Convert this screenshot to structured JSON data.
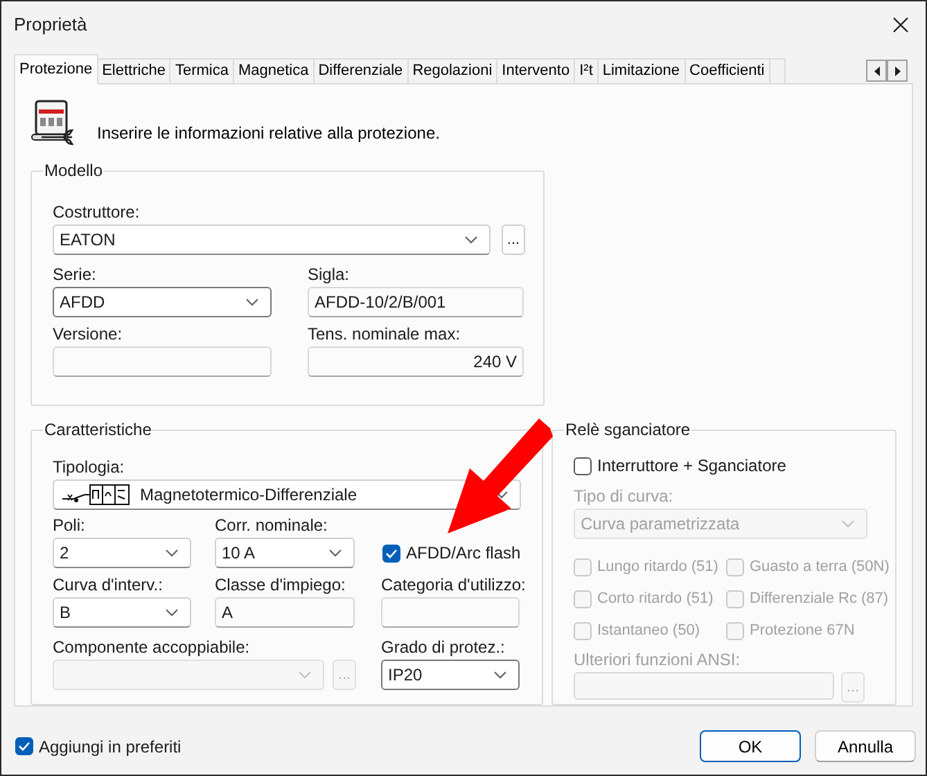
{
  "window": {
    "title": "Proprietà"
  },
  "tabs": [
    {
      "label": "Protezione",
      "selected": true
    },
    {
      "label": "Elettriche",
      "selected": false
    },
    {
      "label": "Termica",
      "selected": false
    },
    {
      "label": "Magnetica",
      "selected": false
    },
    {
      "label": "Differenziale",
      "selected": false
    },
    {
      "label": "Regolazioni",
      "selected": false
    },
    {
      "label": "Intervento",
      "selected": false
    },
    {
      "label": "I²t",
      "selected": false
    },
    {
      "label": "Limitazione",
      "selected": false
    },
    {
      "label": "Coefficienti",
      "selected": false
    }
  ],
  "intro": "Inserire le informazioni relative alla protezione.",
  "modello": {
    "legend": "Modello",
    "costruttore": {
      "label": "Costruttore:",
      "value": "EATON",
      "button": "..."
    },
    "serie": {
      "label": "Serie:",
      "value": "AFDD"
    },
    "sigla": {
      "label": "Sigla:",
      "value": "AFDD-10/2/B/001"
    },
    "versione": {
      "label": "Versione:"
    },
    "tensione": {
      "label": "Tens. nominale max:",
      "value": "240 V"
    }
  },
  "caratteristiche": {
    "legend": "Caratteristiche",
    "tipologia": {
      "label": "Tipologia:",
      "value": "Magnetotermico-Differenziale"
    },
    "poli": {
      "label": "Poli:",
      "value": "2"
    },
    "corrente": {
      "label": "Corr. nominale:",
      "value": "10 A"
    },
    "afdd": {
      "label": "AFDD/Arc flash",
      "checked": true
    },
    "curva": {
      "label": "Curva d'interv.:",
      "value": "B"
    },
    "classe": {
      "label": "Classe d'impiego:",
      "value": "A"
    },
    "categoria": {
      "label": "Categoria d'utilizzo:"
    },
    "componente": {
      "label": "Componente accoppiabile:",
      "button": "...",
      "disabled": true
    },
    "grado": {
      "label": "Grado di protez.:",
      "value": "IP20"
    }
  },
  "rele": {
    "legend": "Relè sganciatore",
    "interruttore": {
      "label": "Interruttore + Sganciatore",
      "checked": false
    },
    "tipo_curva": {
      "label": "Tipo di curva:",
      "value": "Curva parametrizzata",
      "disabled": true
    },
    "funzioni": [
      {
        "label": "Lungo ritardo (51)",
        "checked": false,
        "disabled": true
      },
      {
        "label": "Guasto a terra (50N)",
        "checked": false,
        "disabled": true
      },
      {
        "label": "Corto ritardo (51)",
        "checked": false,
        "disabled": true
      },
      {
        "label": "Differenziale Rc (87)",
        "checked": false,
        "disabled": true
      },
      {
        "label": "Istantaneo (50)",
        "checked": false,
        "disabled": true
      },
      {
        "label": "Protezione 67N",
        "checked": false,
        "disabled": true
      }
    ],
    "ansi": {
      "label": "Ulteriori funzioni ANSI:",
      "button": "...",
      "disabled": true
    }
  },
  "preferiti": {
    "label": "Aggiungi in preferiti",
    "checked": true
  },
  "buttons": [
    {
      "label": "OK",
      "default": true
    },
    {
      "label": "Annulla",
      "default": false
    }
  ]
}
